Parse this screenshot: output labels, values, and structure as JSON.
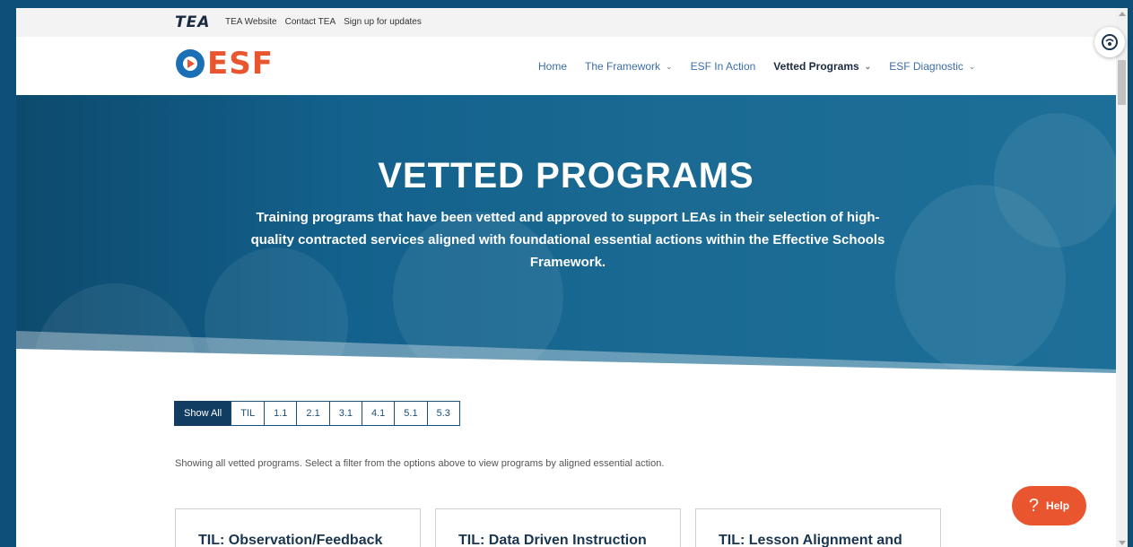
{
  "topbar": {
    "logo": "TEA",
    "links": [
      "TEA Website",
      "Contact TEA",
      "Sign up for updates"
    ]
  },
  "header": {
    "logo_text": "ESF",
    "nav": [
      {
        "label": "Home",
        "dropdown": false,
        "active": false
      },
      {
        "label": "The Framework",
        "dropdown": true,
        "active": false
      },
      {
        "label": "ESF In Action",
        "dropdown": false,
        "active": false
      },
      {
        "label": "Vetted Programs",
        "dropdown": true,
        "active": true
      },
      {
        "label": "ESF Diagnostic",
        "dropdown": true,
        "active": false
      }
    ]
  },
  "hero": {
    "title": "VETTED PROGRAMS",
    "subtitle": "Training programs that have been vetted and approved to support LEAs in their selection of high-quality contracted services aligned with foundational essential actions within the Effective Schools Framework."
  },
  "filters": {
    "options": [
      "Show All",
      "TIL",
      "1.1",
      "2.1",
      "3.1",
      "4.1",
      "5.1",
      "5.3"
    ],
    "selected": "Show All"
  },
  "showing_text": "Showing all vetted programs. Select a filter from the options above to view programs by aligned essential action.",
  "cards": [
    {
      "title": "TIL: Observation/Feedback"
    },
    {
      "title": "TIL: Data Driven Instruction"
    },
    {
      "title": "TIL: Lesson Alignment and"
    }
  ],
  "help": {
    "label": "Help",
    "icon": "question-icon"
  },
  "colors": {
    "brand_orange": "#e9552f",
    "brand_blue": "#1a6fb5",
    "navy": "#123d62",
    "frame": "#0d4f78"
  }
}
